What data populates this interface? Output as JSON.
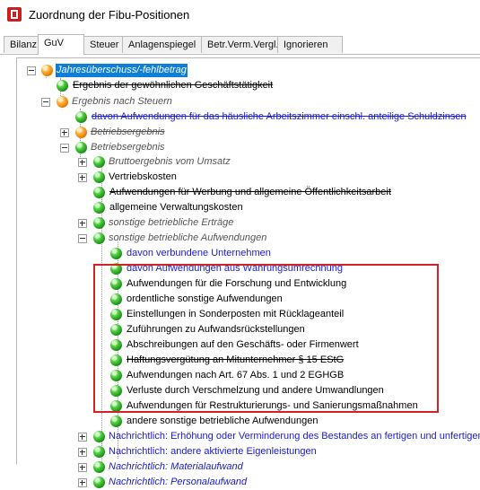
{
  "window": {
    "title": "Zuordnung der Fibu-Positionen"
  },
  "tabs": [
    {
      "label": "Bilanz",
      "active": false
    },
    {
      "label": "GuV",
      "active": true
    },
    {
      "label": "Steuer",
      "active": false
    },
    {
      "label": "Anlagenspiegel",
      "active": false
    },
    {
      "label": "Betr.Verm.Vergl.",
      "active": false
    },
    {
      "label": "Ignorieren",
      "active": false
    }
  ],
  "tree": [
    {
      "label": "Jahresüberschuss/-fehlbetrag",
      "icon": "orange",
      "style": "selected italic"
    },
    {
      "label": "Ergebnis der gewöhnlichen Geschäftstätigkeit",
      "icon": "green",
      "style": "strike"
    },
    {
      "label": "Ergebnis nach Steuern",
      "icon": "orange",
      "style": "gray italic"
    },
    {
      "label": "davon Aufwendungen für das häusliche Arbeitszimmer einschl. anteilige Schuldzinsen",
      "icon": "green",
      "style": "blue strike"
    },
    {
      "label": "Betriebsergebnis",
      "icon": "orange",
      "style": "gray italic strike"
    },
    {
      "label": "Betriebsergebnis",
      "icon": "green",
      "style": "gray italic"
    },
    {
      "label": "Bruttoergebnis vom Umsatz",
      "icon": "green",
      "style": "gray italic"
    },
    {
      "label": "Vertriebskosten",
      "icon": "green",
      "style": ""
    },
    {
      "label": "Aufwendungen für Werbung und allgemeine Öffentlichkeitsarbeit",
      "icon": "green",
      "style": "strike"
    },
    {
      "label": "allgemeine Verwaltungskosten",
      "icon": "green",
      "style": ""
    },
    {
      "label": "sonstige betriebliche Erträge",
      "icon": "green",
      "style": "gray italic"
    },
    {
      "label": "sonstige betriebliche Aufwendungen",
      "icon": "green",
      "style": "gray italic"
    },
    {
      "label": "davon verbundene Unternehmen",
      "icon": "green",
      "style": "blue"
    },
    {
      "label": "davon Aufwendungen aus Währungsumrechnung",
      "icon": "green",
      "style": "blue"
    },
    {
      "label": "Aufwendungen für die Forschung und Entwicklung",
      "icon": "green",
      "style": ""
    },
    {
      "label": "ordentliche sonstige Aufwendungen",
      "icon": "green",
      "style": ""
    },
    {
      "label": "Einstellungen in Sonderposten mit Rücklageanteil",
      "icon": "green",
      "style": ""
    },
    {
      "label": "Zuführungen zu Aufwandsrückstellungen",
      "icon": "green",
      "style": ""
    },
    {
      "label": "Abschreibungen auf den Geschäfts- oder Firmenwert",
      "icon": "green",
      "style": ""
    },
    {
      "label": "Haftungsvergütung an Mitunternehmer § 15 EStG",
      "icon": "green",
      "style": "strike"
    },
    {
      "label": "Aufwendungen nach Art. 67 Abs. 1 und 2 EGHGB",
      "icon": "green",
      "style": ""
    },
    {
      "label": "Verluste durch Verschmelzung und andere Umwandlungen",
      "icon": "green",
      "style": ""
    },
    {
      "label": "Aufwendungen für Restrukturierungs- und Sanierungsmaßnahmen",
      "icon": "green",
      "style": ""
    },
    {
      "label": "andere sonstige betriebliche Aufwendungen",
      "icon": "green",
      "style": ""
    },
    {
      "label": "Nachrichtlich: Erhöhung oder Verminderung des Bestandes an fertigen und unfertigen E",
      "icon": "green",
      "style": "blue"
    },
    {
      "label": "Nachrichtlich: andere aktivierte Eigenleistungen",
      "icon": "green",
      "style": "blue"
    },
    {
      "label": "Nachrichtlich: Materialaufwand",
      "icon": "green",
      "style": "blue italic"
    },
    {
      "label": "Nachrichtlich: Personalaufwand",
      "icon": "green",
      "style": "blue italic"
    }
  ]
}
